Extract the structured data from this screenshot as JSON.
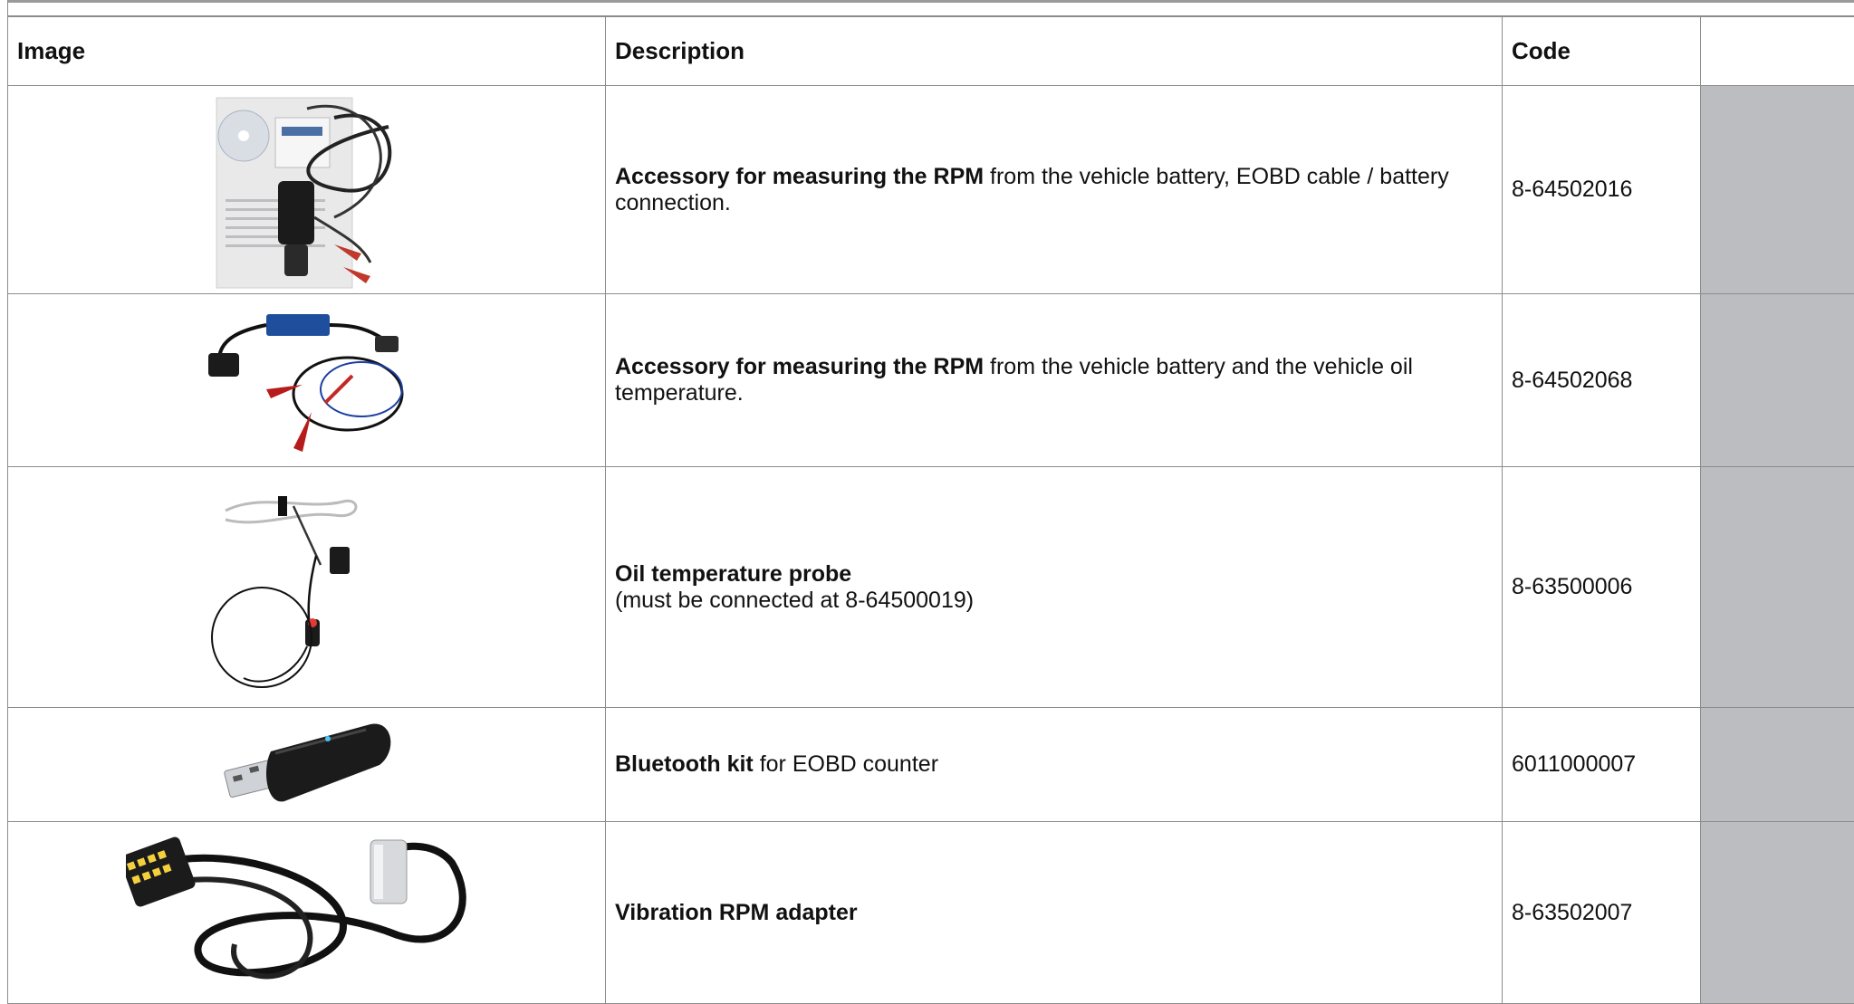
{
  "table": {
    "headers": {
      "image": "Image",
      "description": "Description",
      "code": "Code",
      "extra": ""
    },
    "rows": [
      {
        "image": "rpm-battery-eobd-kit",
        "desc_bold": "Accessory for measuring the RPM",
        "desc_rest": " from the vehicle battery, EOBD cable / battery connection.",
        "code": "8-64502016"
      },
      {
        "image": "rpm-battery-oil-kit",
        "desc_bold": "Accessory for measuring the RPM",
        "desc_rest": " from the vehicle battery and the vehicle oil temperature.",
        "code": "8-64502068"
      },
      {
        "image": "oil-temperature-probe",
        "desc_bold": "Oil temperature probe",
        "desc_rest": "(must be connected at 8-64500019)",
        "code": "8-63500006"
      },
      {
        "image": "bluetooth-dongle",
        "desc_bold": "Bluetooth kit",
        "desc_rest": " for EOBD counter",
        "code": "6011000007"
      },
      {
        "image": "vibration-adapter",
        "desc_bold": "Vibration RPM adapter",
        "desc_rest": "",
        "code": "8-63502007"
      }
    ]
  },
  "colors": {
    "border": "#8c8c8c",
    "extra_column": "#bcbdc1",
    "text": "#111111"
  }
}
